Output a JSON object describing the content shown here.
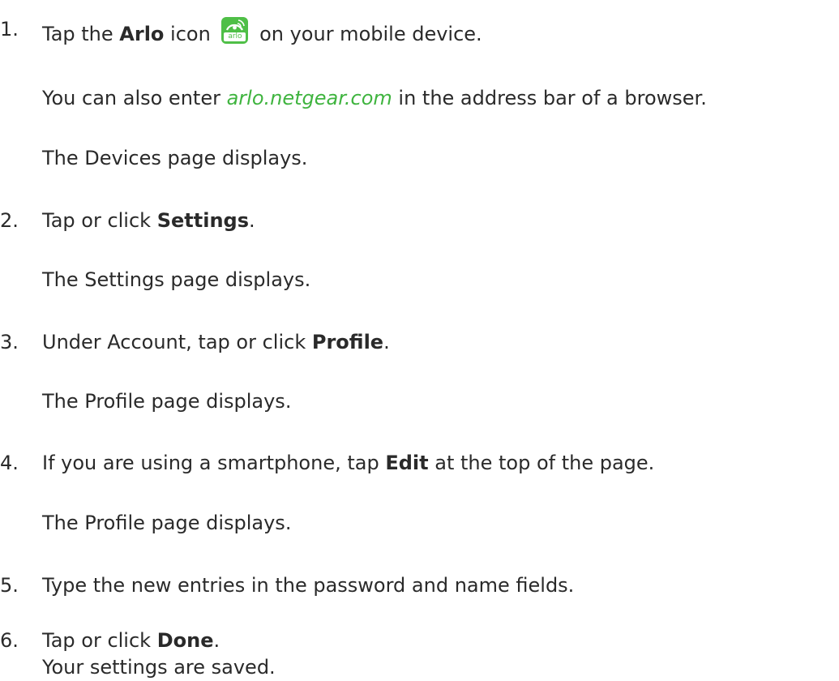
{
  "steps": [
    {
      "number": "1.",
      "text_before": "Tap the ",
      "bold": "Arlo",
      "text_middle": " icon",
      "icon": {
        "name": "arlo-app-icon",
        "label": "arlo",
        "color": "#4fbf47"
      },
      "text_after": " on your mobile device.",
      "note_before": "You can also enter ",
      "link": "arlo.netgear.com",
      "note_after": " in the address bar of a browser.",
      "result": "The Devices page displays."
    },
    {
      "number": "2.",
      "text_before": "Tap or click ",
      "bold": "Settings",
      "text_after": ".",
      "result": "The Settings page displays."
    },
    {
      "number": "3.",
      "text_before": "Under Account, tap or click ",
      "bold": "Profile",
      "text_after": ".",
      "result": "The Profile page displays."
    },
    {
      "number": "4.",
      "text_before": "If you are using a smartphone, tap ",
      "bold": "Edit",
      "text_after": " at the top of the page.",
      "result": "The Profile page displays."
    },
    {
      "number": "5.",
      "text": "Type the new entries in the password and name fields."
    },
    {
      "number": "6.",
      "text_before": "Tap or click ",
      "bold": "Done",
      "text_after": ".",
      "result": "Your settings are saved."
    }
  ],
  "colors": {
    "link": "#3fb43f",
    "text": "#2a2a2a",
    "icon_bg": "#4fbf47"
  }
}
